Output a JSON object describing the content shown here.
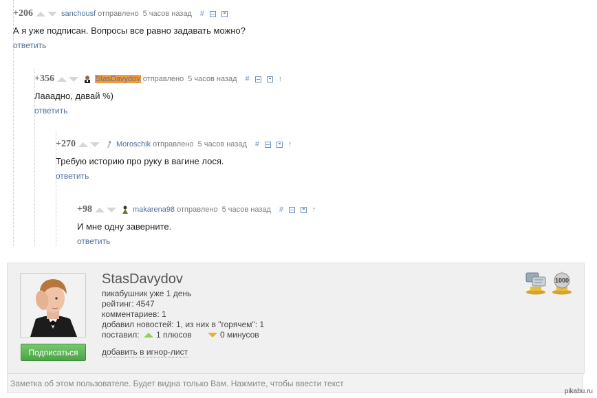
{
  "comments": [
    {
      "rating": "+206",
      "author": "sanchousf",
      "sent": "отправлено",
      "time": "5 часов назад",
      "hash": "#",
      "text": "А я уже подписан. Вопросы все равно задавать можно?",
      "reply": "ответить",
      "up_arrow": ""
    },
    {
      "rating": "+356",
      "author": "StasDavydov",
      "sent": "отправлено",
      "time": "5 часов назад",
      "hash": "#",
      "text": "Лааадно, давай %)",
      "reply": "ответить",
      "up_arrow": "↑"
    },
    {
      "rating": "+270",
      "author": "Moroschik",
      "sent": "отправлено",
      "time": "5 часов назад",
      "hash": "#",
      "text": "Требую историю про руку в вагине лося.",
      "reply": "ответить",
      "up_arrow": "↑"
    },
    {
      "rating": "+98",
      "author": "makarena98",
      "sent": "отправлено",
      "time": "5 часов назад",
      "hash": "#",
      "text": "И мне одну заверните.",
      "reply": "ответить",
      "up_arrow": "↑"
    }
  ],
  "profile": {
    "name": "StasDavydov",
    "since": "пикабушник уже 1 день",
    "rating": "рейтинг: 4547",
    "comments": "комментариев: 1",
    "news": "добавил новостей: 1, из них в \"горячем\": 1",
    "voted_prefix": "поставил:",
    "pluses": "1 плюсов",
    "minuses": "0 минусов",
    "subscribe_label": "Подписаться",
    "ignore_label": "добавить в игнор-лист",
    "badge_1000": "1000"
  },
  "note_placeholder": "Заметка об этом пользователе. Будет видна только Вам. Нажмите, чтобы ввести текст",
  "watermark": "pikabu.ru",
  "colors": {
    "link": "#4d6f99",
    "highlight": "#f39a3a",
    "subscribe": "#5cb85c",
    "plus": "#8fcf5a",
    "minus": "#e6b335"
  }
}
